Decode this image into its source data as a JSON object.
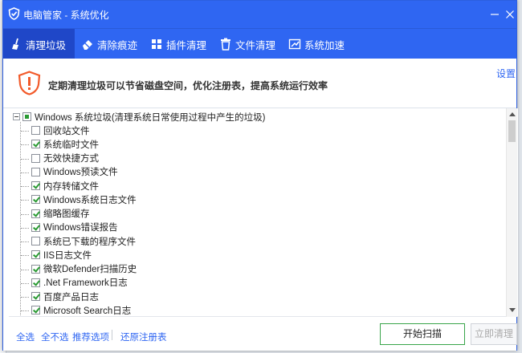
{
  "window": {
    "title": "电脑管家 - 系统优化"
  },
  "tabs": [
    {
      "label": "清理垃圾",
      "icon": "broom-icon",
      "active": true
    },
    {
      "label": "清除痕迹",
      "icon": "eraser-icon",
      "active": false
    },
    {
      "label": "插件清理",
      "icon": "puzzle-icon",
      "active": false
    },
    {
      "label": "文件清理",
      "icon": "trash-icon",
      "active": false
    },
    {
      "label": "系统加速",
      "icon": "speed-icon",
      "active": false
    }
  ],
  "notice": {
    "message": "定期清理垃圾可以节省磁盘空间，优化注册表，提高系统运行效率",
    "settings_label": "设置"
  },
  "tree": {
    "root": {
      "label": "Windows 系统垃圾(清理系统日常使用过程中产生的垃圾)",
      "state": "partial"
    },
    "items": [
      {
        "label": "回收站文件",
        "checked": false
      },
      {
        "label": "系统临时文件",
        "checked": true
      },
      {
        "label": "无效快捷方式",
        "checked": false
      },
      {
        "label": "Windows预读文件",
        "checked": false
      },
      {
        "label": "内存转储文件",
        "checked": true
      },
      {
        "label": "Windows系统日志文件",
        "checked": true
      },
      {
        "label": "缩略图缓存",
        "checked": true
      },
      {
        "label": "Windows错误报告",
        "checked": true
      },
      {
        "label": "系统已下载的程序文件",
        "checked": false
      },
      {
        "label": "IIS日志文件",
        "checked": true
      },
      {
        "label": "微软Defender扫描历史",
        "checked": true
      },
      {
        "label": ".Net Framework日志",
        "checked": true
      },
      {
        "label": "百度产品日志",
        "checked": true
      },
      {
        "label": "Microsoft Search日志",
        "checked": true
      }
    ]
  },
  "footer": {
    "select_all": "全选",
    "select_none": "全不选",
    "recommended": "推荐选项",
    "restore_registry": "还原注册表",
    "scan_button": "开始扫描",
    "clean_button": "立即清理"
  },
  "colors": {
    "brand_blue": "#2f66f2",
    "active_tab": "#1f47c8",
    "check_green": "#2a9a33",
    "warn_orange": "#f25a2a"
  }
}
